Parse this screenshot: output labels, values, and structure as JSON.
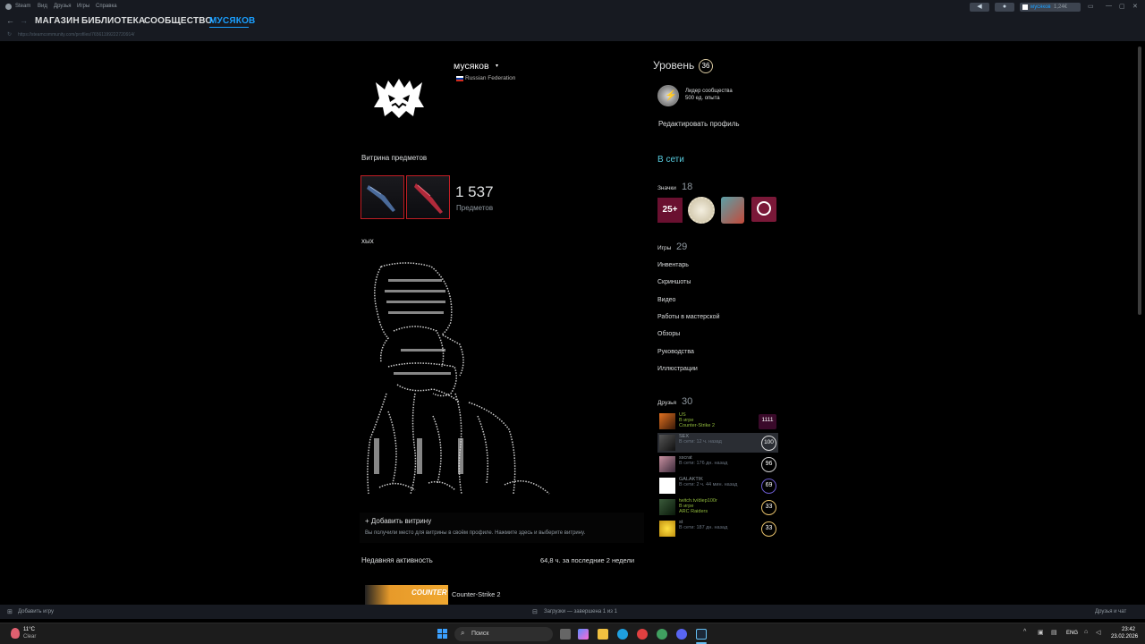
{
  "titlebar": {
    "app": "Steam",
    "menu": [
      "Вид",
      "Друзья",
      "Игры",
      "Справка"
    ],
    "user": "мусяков",
    "balance": "1,24€"
  },
  "nav": {
    "store": "МАГАЗИН",
    "library": "БИБЛИОТЕКА",
    "community": "СООБЩЕСТВО",
    "profile": "МУСЯКОВ"
  },
  "url": "https://steamcommunity.com/profiles/76561199222720914/",
  "profile": {
    "name": "мусяков",
    "country": "Russian Federation",
    "level_label": "Уровень",
    "level": "36",
    "badge_title": "Лидер сообщества",
    "badge_xp": "500 ед. опыта",
    "edit_profile": "Редактировать профиль",
    "status": "В сети"
  },
  "showcase": {
    "title": "Витрина предметов",
    "count": "1 537",
    "count_label": "Предметов",
    "custom_title": "хых",
    "add_showcase": "+ Добавить витрину",
    "add_showcase_desc": "Вы получили место для витрины в своём профиле. Нажмите здесь и выберите витрину."
  },
  "activity": {
    "title": "Недавняя активность",
    "hours": "64,8 ч. за последние 2 недели",
    "game": "Counter-Strike 2",
    "game_banner": "COUNTER"
  },
  "badges": {
    "label": "Значки",
    "count": "18",
    "years": "25+"
  },
  "games": {
    "label": "Игры",
    "count": "29"
  },
  "links": [
    "Инвентарь",
    "Скриншоты",
    "Видео",
    "Работы в мастерской",
    "Обзоры",
    "Руководства",
    "Иллюстрации"
  ],
  "friends": {
    "label": "Друзья",
    "count": "30",
    "list": [
      {
        "name": "US",
        "status": "В игре",
        "game": "Counter-Strike 2",
        "level": "1111"
      },
      {
        "name": "SEX",
        "status": "В сети: 12 ч. назад",
        "game": "",
        "level": "100"
      },
      {
        "name": "sscrat",
        "status": "В сети: 176 дн. назад",
        "game": "",
        "level": "96"
      },
      {
        "name": "GALAKTIK",
        "status": "В сети: 2 ч. 44 мин. назад",
        "game": "",
        "level": "69"
      },
      {
        "name": "twitch.tv/diep100r",
        "status": "В игре",
        "game": "ARC Raiders",
        "level": "33"
      },
      {
        "name": "st",
        "status": "В сети: 187 дн. назад",
        "game": "",
        "level": "33"
      }
    ]
  },
  "bottombar": {
    "add_game": "Добавить игру",
    "downloads": "Загрузки — завершена 1 из 1",
    "friends_chat": "Друзья и чат"
  },
  "taskbar": {
    "weather_temp": "11°C",
    "weather_desc": "Clear",
    "search": "Поиск",
    "lang": "ENG",
    "time": "23:42",
    "date": "23.02.2026"
  },
  "colors": {
    "accent": "#1a9fff",
    "bg": "#000000",
    "chrome": "#171a21",
    "ingame": "#90ba3c",
    "online": "#57cbde"
  }
}
